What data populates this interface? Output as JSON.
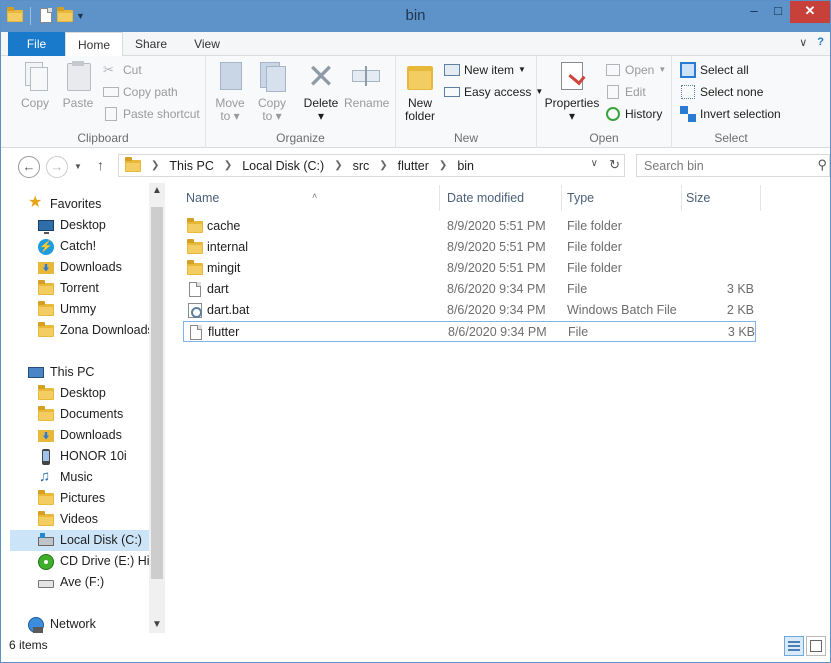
{
  "window": {
    "title": "bin"
  },
  "ribbon_tabs": {
    "file": "File",
    "home": "Home",
    "share": "Share",
    "view": "View"
  },
  "clipboard": {
    "label": "Clipboard",
    "copy": "Copy",
    "paste": "Paste",
    "cut": "Cut",
    "copy_path": "Copy path",
    "paste_shortcut": "Paste shortcut"
  },
  "organize": {
    "label": "Organize",
    "move_to_1": "Move",
    "move_to_2": "to",
    "copy_to_1": "Copy",
    "copy_to_2": "to",
    "delete": "Delete",
    "rename": "Rename"
  },
  "new_group": {
    "label": "New",
    "new_folder_1": "New",
    "new_folder_2": "folder",
    "new_item": "New item",
    "easy_access": "Easy access"
  },
  "open_group": {
    "label": "Open",
    "properties": "Properties",
    "open": "Open",
    "edit": "Edit",
    "history": "History"
  },
  "select_group": {
    "label": "Select",
    "select_all": "Select all",
    "select_none": "Select none",
    "invert_selection": "Invert selection"
  },
  "address": {
    "crumbs": [
      "This PC",
      "Local Disk (C:)",
      "src",
      "flutter",
      "bin"
    ],
    "search_placeholder": "Search bin"
  },
  "nav": {
    "favorites": "Favorites",
    "fav_items": [
      "Desktop",
      "Catch!",
      "Downloads",
      "Torrent",
      "Ummy",
      "Zona Downloads"
    ],
    "this_pc": "This PC",
    "pc_items": [
      "Desktop",
      "Documents",
      "Downloads",
      "HONOR 10i",
      "Music",
      "Pictures",
      "Videos",
      "Local Disk (C:)",
      "CD Drive (E:) HiSuite",
      "Ave (F:)"
    ],
    "network": "Network"
  },
  "columns": {
    "name": "Name",
    "date": "Date modified",
    "type": "Type",
    "size": "Size"
  },
  "files": [
    {
      "name": "cache",
      "date": "8/9/2020 5:51 PM",
      "type": "File folder",
      "size": "",
      "icon": "folder-icon"
    },
    {
      "name": "internal",
      "date": "8/9/2020 5:51 PM",
      "type": "File folder",
      "size": "",
      "icon": "folder-icon"
    },
    {
      "name": "mingit",
      "date": "8/9/2020 5:51 PM",
      "type": "File folder",
      "size": "",
      "icon": "folder-icon"
    },
    {
      "name": "dart",
      "date": "8/6/2020 9:34 PM",
      "type": "File",
      "size": "3 KB",
      "icon": "file-icon"
    },
    {
      "name": "dart.bat",
      "date": "8/6/2020 9:34 PM",
      "type": "Windows Batch File",
      "size": "2 KB",
      "icon": "batch-file-icon"
    },
    {
      "name": "flutter",
      "date": "8/6/2020 9:34 PM",
      "type": "File",
      "size": "3 KB",
      "icon": "file-icon"
    }
  ],
  "status": {
    "item_count": "6 items"
  },
  "colors": {
    "titlebar": "#5d93c9",
    "file_tab": "#1979ca",
    "selected_nav": "#cce4f7",
    "folder": "#e8b83a"
  }
}
